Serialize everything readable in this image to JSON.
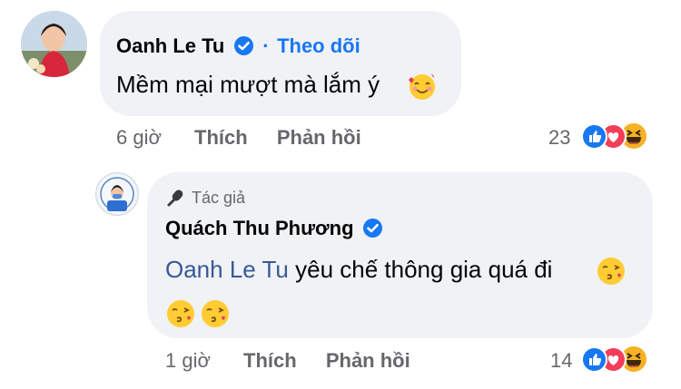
{
  "comment": {
    "author": "Oanh Le Tu",
    "separator": "·",
    "follow_label": "Theo dõi",
    "text": "Mềm mại mượt mà lắm ý",
    "emoji": "smiling-face-with-hearts",
    "time": "6 giờ",
    "like_label": "Thích",
    "reply_label": "Phản hồi",
    "reaction_count": "23",
    "reactions": [
      "like",
      "love",
      "haha"
    ]
  },
  "reply": {
    "badge_label": "Tác giả",
    "author": "Quách Thu Phương",
    "mention": "Oanh Le Tu",
    "text": " yêu chế thông gia quá đi",
    "emojis": [
      "face-blowing-kiss",
      "face-blowing-kiss",
      "face-blowing-kiss"
    ],
    "time": "1 giờ",
    "like_label": "Thích",
    "reply_label": "Phản hồi",
    "reaction_count": "14",
    "reactions": [
      "like",
      "love",
      "haha"
    ]
  },
  "colors": {
    "bubble": "#f0f2f5",
    "link": "#1877f2",
    "mention": "#385898",
    "meta": "#65676b",
    "like": "#1877f2",
    "love": "#f33e58",
    "haha": "#f7b125"
  }
}
